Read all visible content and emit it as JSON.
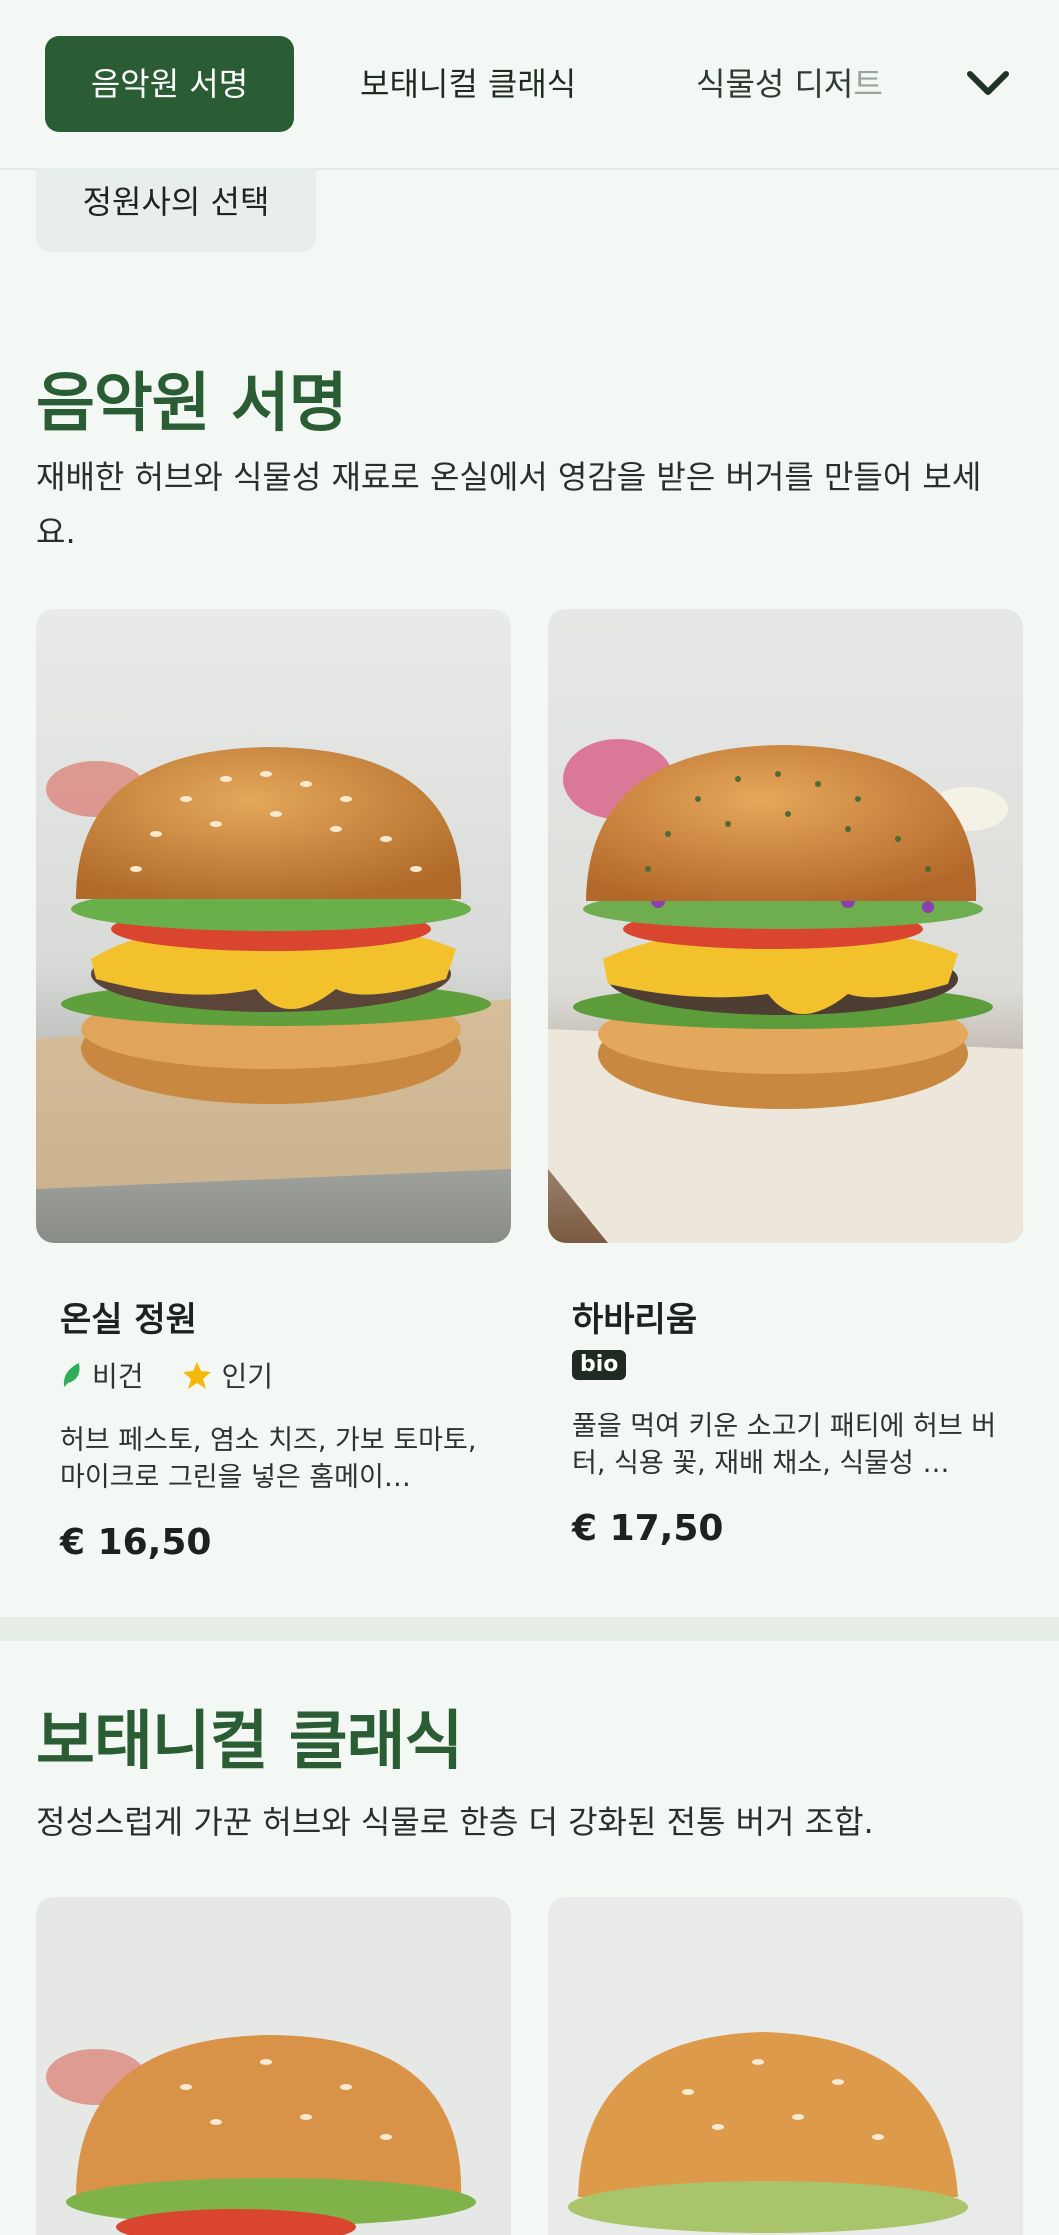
{
  "nav": {
    "tabs": [
      {
        "label": "음악원 서명",
        "active": true
      },
      {
        "label": "보태니컬 클래식",
        "active": false
      },
      {
        "label_main": "식물성 디저",
        "label_fade": "트",
        "active": false
      }
    ],
    "expand_icon": "chevron-down-icon",
    "chip": "정원사의 선택"
  },
  "sections": [
    {
      "title": "음악원 서명",
      "description": "재배한 허브와 식물성 재료로 온실에서 영감을 받은 버거를 만들어 보세요.",
      "items": [
        {
          "name": "온실 정원",
          "tags": [
            "비건",
            "인기"
          ],
          "description": "허브 페스토, 염소 치즈, 가보 토마토, 마이크로 그린을 넣은 홈메이…",
          "price": "€ 16,50"
        },
        {
          "name": "하바리움",
          "badge": "bio",
          "description": "풀을 먹여 키운 소고기 패티에 허브 버터, 식용 꽃, 재배 채소, 식물성 …",
          "price": "€ 17,50"
        }
      ]
    },
    {
      "title": "보태니컬 클래식",
      "description": "정성스럽게 가꾼 허브와 식물로 한층 더 강화된 전통 버거 조합."
    }
  ],
  "colors": {
    "brand": "#2b5d35",
    "background": "#f3f8f4",
    "vegan": "#2fae5a",
    "popular": "#f5b80c"
  }
}
